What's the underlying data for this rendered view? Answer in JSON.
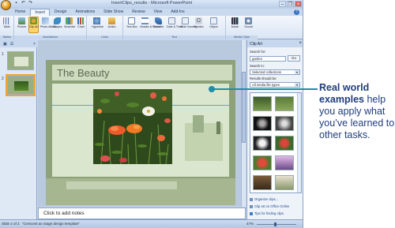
{
  "window": {
    "title": "InsertClips_results - Microsoft PowerPoint",
    "controls": [
      "–",
      "❐",
      "×"
    ]
  },
  "tabs": [
    "Home",
    "Insert",
    "Design",
    "Animations",
    "Slide Show",
    "Review",
    "View",
    "Add-Ins"
  ],
  "ribbon": {
    "groups": [
      {
        "label": "Tables",
        "buttons": [
          {
            "label": "Table"
          }
        ]
      },
      {
        "label": "Illustrations",
        "buttons": [
          {
            "label": "Picture"
          },
          {
            "label": "Clip Art"
          },
          {
            "label": "Photo Album"
          },
          {
            "label": "Shapes"
          },
          {
            "label": "SmartArt"
          },
          {
            "label": "Chart"
          }
        ]
      },
      {
        "label": "Links",
        "buttons": [
          {
            "label": "Hyperlink"
          },
          {
            "label": "Action"
          }
        ]
      },
      {
        "label": "Text",
        "buttons": [
          {
            "label": "Text Box"
          },
          {
            "label": "Header & Footer"
          },
          {
            "label": "WordArt"
          },
          {
            "label": "Date & Time"
          },
          {
            "label": "Slide Number"
          },
          {
            "label": "Symbol"
          },
          {
            "label": "Object"
          }
        ]
      },
      {
        "label": "Media Clips",
        "buttons": [
          {
            "label": "Movie"
          },
          {
            "label": "Sound"
          }
        ]
      }
    ]
  },
  "thumbs_pane": {
    "tab1": "▣",
    "tab2": "☰",
    "close": "×",
    "slide_numbers": [
      "1",
      "2"
    ]
  },
  "slide": {
    "title": "The Beauty"
  },
  "notes": {
    "placeholder": "Click to add notes"
  },
  "statusbar": {
    "slide": "Slide 2 of 2",
    "theme": "\"Crescent an stage design template\"",
    "zoom": "47%"
  },
  "clip_pane": {
    "title": "Clip Art",
    "search_for_label": "Search for:",
    "search_value": "garden",
    "go_label": "Go",
    "search_in_label": "Search in:",
    "search_in_value": "Selected collections",
    "results_label": "Results should be:",
    "results_value": "All media file types",
    "links": [
      "Organize clips...",
      "Clip art on Office Online",
      "Tips for finding clips"
    ]
  },
  "callout": {
    "bold": "Real world examples",
    "rest": " help you apply what you’ve learned to other tasks."
  }
}
